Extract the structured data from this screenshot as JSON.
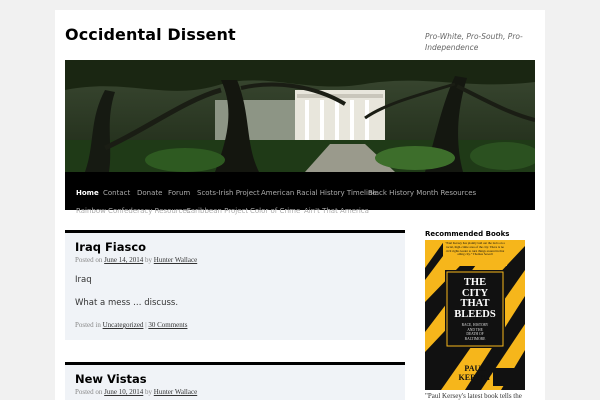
{
  "site": {
    "title": "Occidental Dissent",
    "description": "Pro-White, Pro-South, Pro-Independence"
  },
  "nav": {
    "items": [
      {
        "label": "Home"
      },
      {
        "label": "Contact"
      },
      {
        "label": "Donate"
      },
      {
        "label": "Forum"
      },
      {
        "label": "Scots-Irish Project"
      },
      {
        "label": "American Racial History Timeline"
      },
      {
        "label": "Black History Month Resources"
      },
      {
        "label": "Rainbow Confederacy Resources"
      },
      {
        "label": "Caribbean Project"
      },
      {
        "label": "Color of Crime"
      },
      {
        "label": "Ain't That America"
      }
    ]
  },
  "posts": [
    {
      "title": "Iraq Fiasco",
      "meta_posted_on": "Posted on",
      "date": "June 14, 2014",
      "meta_by": "by",
      "author": "Hunter Wallace",
      "paragraphs": [
        "Iraq",
        "What a mess … discuss."
      ],
      "footer_posted_in": "Posted in",
      "category": "Uncategorized",
      "footer_sep": "|",
      "comments": "30 Comments"
    },
    {
      "title": "New Vistas",
      "meta_posted_on": "Posted on",
      "date": "June 10, 2014",
      "meta_by": "by",
      "author": "Hunter Wallace"
    }
  ],
  "sidebar": {
    "widget_title": "Recommended Books",
    "book": {
      "blurb": "\"Paul Kersey has plainly laid out the facts on a racial, high-crime area of the city. There is no civil rights leader to turn things around in that ailing city.\" Thomas Sowell",
      "title_lines": [
        "THE",
        "CITY",
        "THAT",
        "BLEEDS"
      ],
      "subtitle_lines": [
        "RACE, HISTORY",
        "AND THE",
        "DEATH OF",
        "BALTIMORE"
      ],
      "author_lines": [
        "PAUL",
        "KERSEY"
      ],
      "colors": {
        "yellow": "#f6b61b",
        "black": "#111111"
      }
    },
    "caption": "\"Paul Kersey's latest book tells the"
  }
}
